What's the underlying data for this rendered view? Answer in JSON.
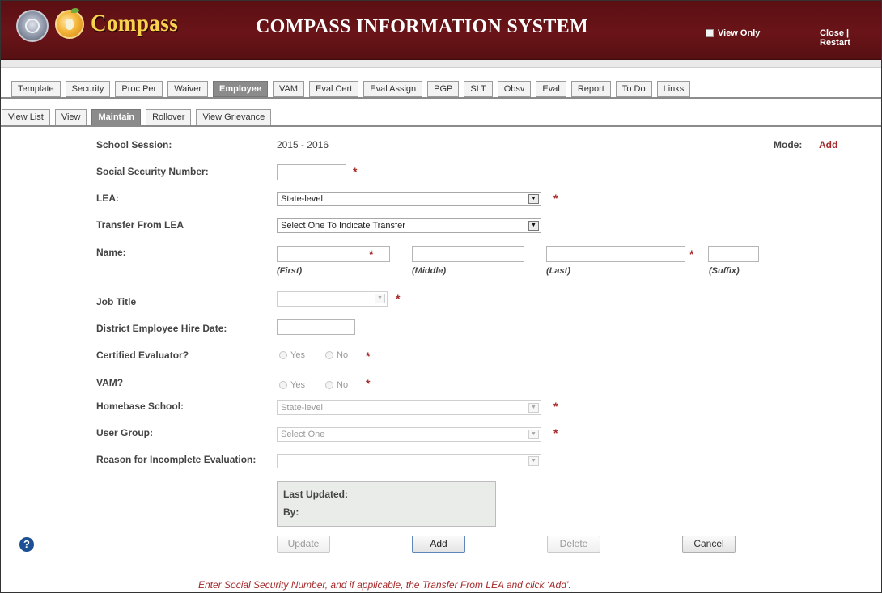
{
  "header": {
    "brand": "Compass",
    "system_title": "COMPASS INFORMATION SYSTEM",
    "view_only_label": "View Only",
    "close_label": "Close",
    "separator": "|",
    "restart_label": "Restart"
  },
  "main_tabs": [
    "Template",
    "Security",
    "Proc Per",
    "Waiver",
    "Employee",
    "VAM",
    "Eval Cert",
    "Eval Assign",
    "PGP",
    "SLT",
    "Obsv",
    "Eval",
    "Report",
    "To Do",
    "Links"
  ],
  "main_tabs_active": "Employee",
  "sub_tabs": [
    "View List",
    "View",
    "Maintain",
    "Rollover",
    "View Grievance"
  ],
  "sub_tabs_active": "Maintain",
  "form": {
    "school_session_label": "School Session:",
    "school_session_value": "2015 - 2016",
    "mode_label": "Mode:",
    "mode_value": "Add",
    "ssn_label": "Social Security Number:",
    "lea_label": "LEA:",
    "lea_value": "State-level",
    "transfer_label": "Transfer From LEA",
    "transfer_value": "Select One To Indicate Transfer",
    "name_label": "Name:",
    "first_label": "(First)",
    "middle_label": "(Middle)",
    "last_label": "(Last)",
    "suffix_label": "(Suffix)",
    "job_title_label": "Job Title",
    "hire_date_label": "District Employee Hire Date:",
    "cert_eval_label": "Certified Evaluator?",
    "vam_label": "VAM?",
    "yes_label": "Yes",
    "no_label": "No",
    "homebase_label": "Homebase School:",
    "homebase_value": "State-level",
    "user_group_label": "User Group:",
    "user_group_value": "Select One",
    "reason_label": "Reason for Incomplete Evaluation:",
    "reason_value": "",
    "required_mark": "*"
  },
  "updated": {
    "last_updated_label": "Last Updated:",
    "by_label": "By:"
  },
  "buttons": {
    "update": "Update",
    "add": "Add",
    "delete": "Delete",
    "cancel": "Cancel"
  },
  "help_icon": "?",
  "message": "Enter Social Security Number, and if applicable, the Transfer From LEA and click ‘Add’.",
  "colors": {
    "header_bg": "#5a0f12",
    "brand": "#f7d24d",
    "required": "#a42a2a",
    "active_tab": "#8b8b8b"
  }
}
